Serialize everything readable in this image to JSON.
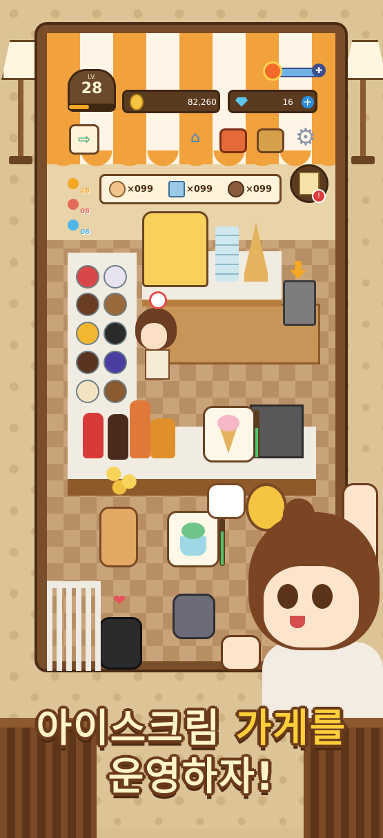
{
  "hud": {
    "level_label": "LV.",
    "level": "28",
    "level_progress": 0.45,
    "coins": "82,260",
    "gems": "16",
    "plus": "+"
  },
  "stock": [
    {
      "name": "egg",
      "count": "×099",
      "color": "#f1c58a"
    },
    {
      "name": "milk",
      "count": "×099",
      "color": "#9cc9e6"
    },
    {
      "name": "chocolate",
      "count": "×099",
      "color": "#8a5a3c"
    }
  ],
  "timers": [
    {
      "value": "28",
      "color": "#f5a623"
    },
    {
      "value": "08",
      "color": "#e66a5a"
    },
    {
      "value": "08",
      "color": "#4fb7e8"
    }
  ],
  "quest_badge": "!",
  "headline": {
    "line1_part1": "아이스크림",
    "line1_part2": "가게를",
    "line2": "운영하자!"
  },
  "icons": {
    "exit": "exit-icon",
    "hanger": "hanger-icon",
    "sofa": "sofa-icon",
    "bag": "bag-icon",
    "gear": "gear-icon",
    "wrench": "wrench-icon"
  },
  "colors": {
    "awning_orange": "#f2a23c",
    "frame_brown": "#7a4e2a",
    "headline_fill": "#fff4c8",
    "headline_outline": "#6b3a1a"
  }
}
